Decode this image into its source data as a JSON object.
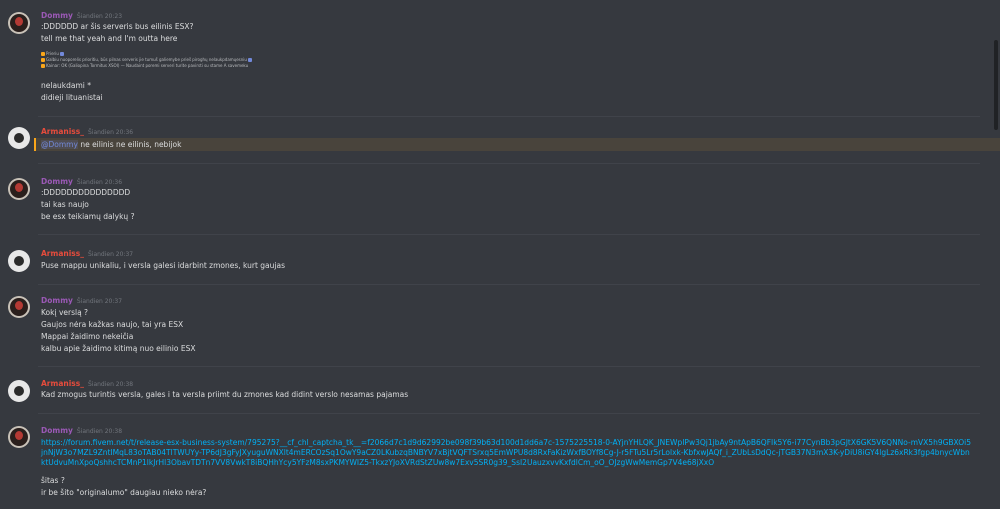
{
  "messages": [
    {
      "author": "Dommy",
      "time": "Šiandien 20:23",
      "lines": [
        ":DDDDDD ar šis serveris bus eilinis ESX?",
        "tell me that yeah and I'm outta here"
      ],
      "embed_lines": [
        "Prieriu",
        "Galbiu nuoporelis prioritiu, būs pilnas serveris jie tumuš galiemybe prieš piroghų nelaukpdamųesniu",
        "Kainar: OK (Galiopina Tormitus XSOI) — Naudaint poremi serveri turite pavirsti su stame A savemeku"
      ],
      "after_lines": [
        "nelaukdami *",
        "didieji lituanistai"
      ]
    },
    {
      "author": "Armaniss_",
      "time": "Šiandien 20:36",
      "mention": "@Dommy",
      "lines": [
        "ne eilinis ne eilinis, nebijok"
      ]
    },
    {
      "author": "Dommy",
      "time": "Šiandien 20:36",
      "lines": [
        ":DDDDDDDDDDDDDDD",
        "tai kas naujo",
        "be esx teikiamų dalykų ?"
      ]
    },
    {
      "author": "Armaniss_",
      "time": "Šiandien 20:37",
      "lines": [
        "Puse mappu unikaliu, i versla galesi idarbint zmones, kurt gaujas"
      ]
    },
    {
      "author": "Dommy",
      "time": "Šiandien 20:37",
      "lines": [
        "Kokį verslą ?",
        "Gaujos nėra kažkas naujo, tai yra ESX",
        "Mappai žaidimo nekeičia",
        "kalbu apie žaidimo kitimą nuo eilinio ESX"
      ]
    },
    {
      "author": "Armaniss_",
      "time": "Šiandien 20:38",
      "lines": [
        "Kad zmogus turintis versla, gales i ta versla priimt du zmones kad didint verslo nesamas pajamas"
      ]
    },
    {
      "author": "Dommy",
      "time": "Šiandien 20:38",
      "link": "https://forum.fivem.net/t/release-esx-business-system/795275?__cf_chl_captcha_tk__=f2066d7c1d9d62992be098f39b63d100d1dd6a7c-1575225518-0-AYjnYHLQK_JNEWpIPw3Qj1jbAy9ntApB6QFIk5Y6-i77CynBb3pGJtX6GK5V6QNNo-mVX5h9GBXOi5jnNjW3o7MZL9ZntIMqL83oTAB04TlTWUYy-TP6dJ3gFyJXyuguWNXlt4mERCOzSq1OwY9aCZ0LKubzqBNBYV7xBjtVQFTSrxq5EmWPU8d8RxFaKizWxfBOYf8Cg-J-r5FTu5Lr5rLolxk-KbfxwJAQf_i_ZUbLsDdQc-jTGB37N3mX3K-yDiU8iGY4lgLz6xRk3fgp4bnycWbnktUdvuMnXpoQshhcTCMnP1lkJrHl3ObavTDTn7VV8VwkT8iBQHhYcy5YFzM8sxPKMYWIZ5-TkxzYJoXVRdStZUw8w7Exv5SR0g39_SsI2UauzxvvKxfdlCm_oO_OJzgWwMemGp7V4e68jXxO",
      "lines": [
        "šitas ?",
        "ir be šito \"originalumo\" daugiau nieko nėra?"
      ]
    }
  ],
  "colors": {
    "background": "#36393f",
    "dommy": "#9b59b6",
    "armaniss": "#e74c3c",
    "mention_highlight": "#faa61a",
    "link": "#00b0f4"
  }
}
